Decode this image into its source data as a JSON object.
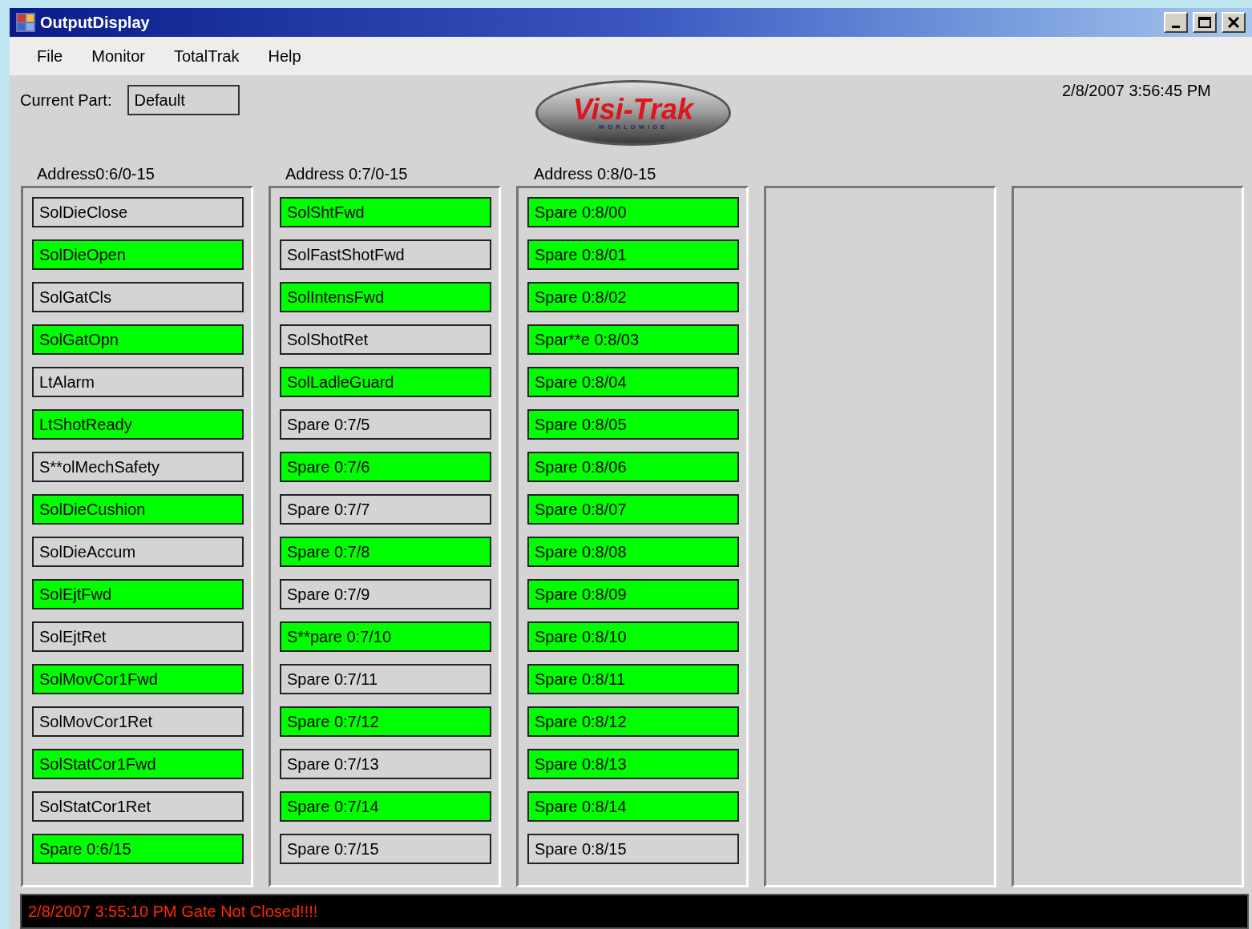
{
  "window": {
    "title": "OutputDisplay"
  },
  "menu": [
    "File",
    "Monitor",
    "TotalTrak",
    "Help"
  ],
  "current_part": {
    "label": "Current Part:",
    "value": "Default"
  },
  "logo": {
    "text": "Visi-Trak",
    "subtext": "WORLDWIDE"
  },
  "datetime": "2/8/2007 3:56:45 PM",
  "panels": [
    {
      "kind": "outputs",
      "heading": "Address0:6/0-15",
      "outputs": [
        {
          "label": "SolDieClose",
          "on": false
        },
        {
          "label": "SolDieOpen",
          "on": true
        },
        {
          "label": "SolGatCls",
          "on": false
        },
        {
          "label": "SolGatOpn",
          "on": true
        },
        {
          "label": "LtAlarm",
          "on": false
        },
        {
          "label": "LtShotReady",
          "on": true
        },
        {
          "label": "S**olMechSafety",
          "on": false
        },
        {
          "label": "SolDieCushion",
          "on": true
        },
        {
          "label": "SolDieAccum",
          "on": false
        },
        {
          "label": "SolEjtFwd",
          "on": true
        },
        {
          "label": "SolEjtRet",
          "on": false
        },
        {
          "label": "SolMovCor1Fwd",
          "on": true
        },
        {
          "label": "SolMovCor1Ret",
          "on": false
        },
        {
          "label": "SolStatCor1Fwd",
          "on": true
        },
        {
          "label": "SolStatCor1Ret",
          "on": false
        },
        {
          "label": "Spare 0:6/15",
          "on": true
        }
      ]
    },
    {
      "kind": "outputs",
      "heading": "Address 0:7/0-15",
      "outputs": [
        {
          "label": "SolShtFwd",
          "on": true
        },
        {
          "label": "SolFastShotFwd",
          "on": false
        },
        {
          "label": "SolIntensFwd",
          "on": true
        },
        {
          "label": "SolShotRet",
          "on": false
        },
        {
          "label": "SolLadleGuard",
          "on": true
        },
        {
          "label": "Spare 0:7/5",
          "on": false
        },
        {
          "label": "Spare 0:7/6",
          "on": true
        },
        {
          "label": "Spare 0:7/7",
          "on": false
        },
        {
          "label": "Spare 0:7/8",
          "on": true
        },
        {
          "label": "Spare 0:7/9",
          "on": false
        },
        {
          "label": "S**pare 0:7/10",
          "on": true
        },
        {
          "label": "Spare 0:7/11",
          "on": false
        },
        {
          "label": "Spare 0:7/12",
          "on": true
        },
        {
          "label": "Spare 0:7/13",
          "on": false
        },
        {
          "label": "Spare 0:7/14",
          "on": true
        },
        {
          "label": "Spare 0:7/15",
          "on": false
        }
      ]
    },
    {
      "kind": "outputs",
      "heading": "Address 0:8/0-15",
      "outputs": [
        {
          "label": "Spare 0:8/00",
          "on": true
        },
        {
          "label": "Spare 0:8/01",
          "on": true
        },
        {
          "label": "Spare 0:8/02",
          "on": true
        },
        {
          "label": "Spar**e 0:8/03",
          "on": true
        },
        {
          "label": "Spare 0:8/04",
          "on": true
        },
        {
          "label": "Spare 0:8/05",
          "on": true
        },
        {
          "label": "Spare 0:8/06",
          "on": true
        },
        {
          "label": "Spare 0:8/07",
          "on": true
        },
        {
          "label": "Spare 0:8/08",
          "on": true
        },
        {
          "label": "Spare 0:8/09",
          "on": true
        },
        {
          "label": "Spare 0:8/10",
          "on": true
        },
        {
          "label": "Spare 0:8/11",
          "on": true
        },
        {
          "label": "Spare 0:8/12",
          "on": true
        },
        {
          "label": "Spare 0:8/13",
          "on": true
        },
        {
          "label": "Spare 0:8/14",
          "on": true
        },
        {
          "label": "Spare 0:8/15",
          "on": false
        }
      ]
    },
    {
      "kind": "empty"
    },
    {
      "kind": "empty"
    }
  ],
  "status_message": "2/8/2007 3:55:10 PM Gate Not Closed!!!!"
}
